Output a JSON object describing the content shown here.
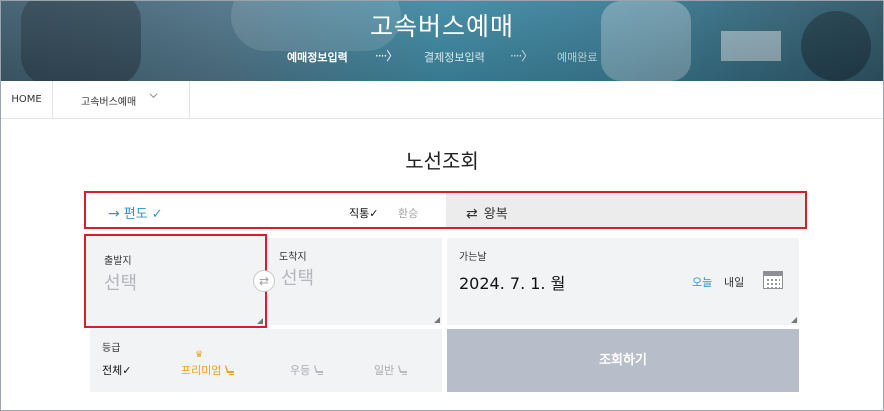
{
  "header": {
    "title": "고속버스예매",
    "steps": [
      {
        "label": "예매정보입력",
        "state": "active"
      },
      {
        "label": "결제정보입력",
        "state": "pending"
      },
      {
        "label": "예매완료",
        "state": "pending"
      }
    ],
    "step_arrow": "····〉"
  },
  "breadcrumb": {
    "home": "HOME",
    "current": "고속버스예매"
  },
  "page_title": "노선조회",
  "trip_type": {
    "oneway": "편도",
    "oneway_check": "✓",
    "direct": "직통✓",
    "transfer": "환승",
    "roundtrip": "왕복"
  },
  "departure": {
    "label": "출발지",
    "placeholder": "선택"
  },
  "arrival": {
    "label": "도착지",
    "placeholder": "선택"
  },
  "swap_icon": "⇄",
  "date": {
    "label": "가는날",
    "value": "2024. 7. 1. 월",
    "today": "오늘",
    "tomorrow": "내일"
  },
  "grade": {
    "label": "등급",
    "options": [
      {
        "label": "전체✓",
        "selected": true
      },
      {
        "label": "프리미엄",
        "selected": false
      },
      {
        "label": "우등",
        "selected": false
      },
      {
        "label": "일반",
        "selected": false
      }
    ]
  },
  "search_button": "조회하기",
  "colors": {
    "accent_blue": "#2b97c9",
    "highlight_red": "#d61f2c",
    "premium_orange": "#f0a21a",
    "button_gray": "#b7bdc9"
  }
}
